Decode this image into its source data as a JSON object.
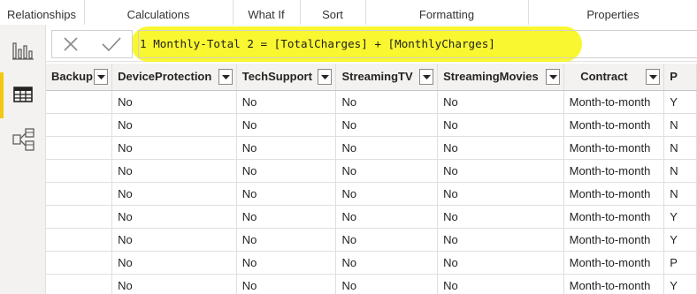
{
  "ribbon": {
    "groups": [
      {
        "label": "Relationships"
      },
      {
        "label": "Calculations"
      },
      {
        "label": "What If"
      },
      {
        "label": "Sort"
      },
      {
        "label": "Formatting"
      },
      {
        "label": "Properties"
      }
    ]
  },
  "nav": {
    "items": [
      {
        "name": "report-view",
        "icon": "bar-chart-icon",
        "selected": false
      },
      {
        "name": "data-view",
        "icon": "table-icon",
        "selected": true
      },
      {
        "name": "model-view",
        "icon": "model-icon",
        "selected": false
      }
    ],
    "accent_color": "#f2c811"
  },
  "formula_bar": {
    "cancel_icon": "close-icon",
    "commit_icon": "check-icon",
    "line_number": "1",
    "expression": "Monthly-Total 2 = [TotalCharges] + [MonthlyCharges]",
    "highlight_color": "#f9f61d"
  },
  "table": {
    "columns": [
      {
        "label": "Backup"
      },
      {
        "label": "DeviceProtection"
      },
      {
        "label": "TechSupport"
      },
      {
        "label": "StreamingTV"
      },
      {
        "label": "StreamingMovies"
      },
      {
        "label": "Contract"
      },
      {
        "label": "P"
      }
    ],
    "rows": [
      [
        "",
        "No",
        "No",
        "No",
        "No",
        "Month-to-month",
        "Y"
      ],
      [
        "",
        "No",
        "No",
        "No",
        "No",
        "Month-to-month",
        "N"
      ],
      [
        "",
        "No",
        "No",
        "No",
        "No",
        "Month-to-month",
        "N"
      ],
      [
        "",
        "No",
        "No",
        "No",
        "No",
        "Month-to-month",
        "N"
      ],
      [
        "",
        "No",
        "No",
        "No",
        "No",
        "Month-to-month",
        "N"
      ],
      [
        "",
        "No",
        "No",
        "No",
        "No",
        "Month-to-month",
        "Y"
      ],
      [
        "",
        "No",
        "No",
        "No",
        "No",
        "Month-to-month",
        "Y"
      ],
      [
        "",
        "No",
        "No",
        "No",
        "No",
        "Month-to-month",
        "P"
      ],
      [
        "",
        "No",
        "No",
        "No",
        "No",
        "Month-to-month",
        "Y"
      ]
    ]
  }
}
